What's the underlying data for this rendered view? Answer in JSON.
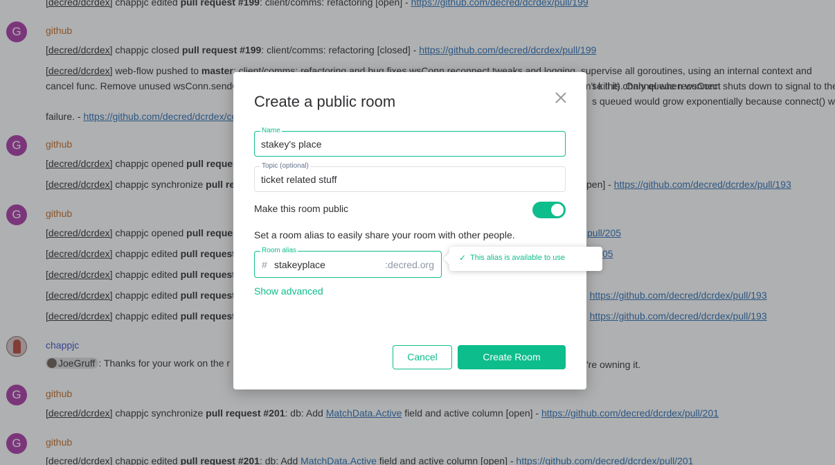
{
  "timeline": {
    "row0": {
      "repo": "[decred/dcrdex]",
      "mid": " chappjc edited ",
      "pr": "pull request #199",
      "desc": ": client/comms: refactoring [open] - ",
      "link": "https://github.com/decred/dcrdex/pull/199"
    },
    "group1": {
      "avatar": "G",
      "sender": "github",
      "row1": {
        "repo": "[decred/dcrdex]",
        "mid": " chappjc closed ",
        "pr": "pull request #199",
        "desc": ": client/comms: refactoring [closed] - ",
        "link": "https://github.com/decred/dcrdex/pull/199"
      },
      "row2": {
        "repo": "[decred/dcrdex]",
        "mid": " web-flow pushed to ",
        "branch": "master",
        "desc": ": client/comms: refactoring and bug fixes wsConn reconnect tweaks and logging. supervise all goroutines, using an internal context and cancel func. Remove unused wsConn.sendCh field. Allow (*wsConn).Connect to be called multiple times with dead (if they didn't kill it). Only queue reconnect ",
        "tail": "se this channel when wsConn shuts down to signal to the",
        "tail2": "s queued would grow exponentially because connect() was",
        "pre_link": "failure. - ",
        "link": "https://github.com/decred/dcrdex/co"
      }
    },
    "group2": {
      "avatar": "G",
      "sender": "github",
      "row1": {
        "repo": "[decred/dcrdex]",
        "mid": " chappjc opened ",
        "pr": "pull request"
      },
      "row2": {
        "repo": "[decred/dcrdex]",
        "mid": " chappjc synchronize ",
        "pr": "pull re",
        "tail": "pen] - ",
        "link": "https://github.com/decred/dcrdex/pull/193"
      }
    },
    "group3": {
      "avatar": "G",
      "sender": "github",
      "rows": [
        {
          "repo": "[decred/dcrdex]",
          "mid": " chappjc opened ",
          "pr": "pull request",
          "tail_link": "pull/205"
        },
        {
          "repo": "[decred/dcrdex]",
          "mid": " chappjc edited ",
          "pr": "pull request",
          "tail_link": "05"
        },
        {
          "repo": "[decred/dcrdex]",
          "mid": " chappjc edited ",
          "pr": "pull request"
        },
        {
          "repo": "[decred/dcrdex]",
          "mid": " chappjc edited ",
          "pr": "pull request",
          "tail": "- ",
          "link": "https://github.com/decred/dcrdex/pull/193"
        },
        {
          "repo": "[decred/dcrdex]",
          "mid": " chappjc edited ",
          "pr": "pull request",
          "tail": "- ",
          "link": "https://github.com/decred/dcrdex/pull/193"
        }
      ]
    },
    "group4": {
      "sender": "chappjc",
      "mention": "JoeGruff",
      "text": ": Thanks for your work on the r",
      "tail": "'re owning it."
    },
    "group5": {
      "avatar": "G",
      "sender": "github",
      "row1": {
        "repo": "[decred/dcrdex]",
        "mid": " chappjc synchronize ",
        "pr": "pull request #201",
        "desc1": ": db: Add ",
        "code": "MatchData.Active",
        "desc2": " field and active column [open] - ",
        "link": "https://github.com/decred/dcrdex/pull/201"
      }
    },
    "group6": {
      "avatar": "G",
      "sender": "github",
      "row1": {
        "repo": "[decred/dcrdex]",
        "mid": " chappjc edited ",
        "pr": "pull request #201",
        "desc1": ": db: Add ",
        "code": "MatchData.Active",
        "desc2": " field and active column [open] - ",
        "link": "https://github.com/decred/dcrdex/pull/201"
      }
    }
  },
  "dialog": {
    "title": "Create a public room",
    "name_label": "Name",
    "name_value": "stakey's place",
    "topic_label": "Topic (optional)",
    "topic_value": "ticket related stuff",
    "public_label": "Make this room public",
    "public_enabled": true,
    "alias_description": "Set a room alias to easily share your room with other people.",
    "alias_label": "Room alias",
    "alias_prefix": "#",
    "alias_value": "stakeyplace",
    "alias_domain": ":decred.org",
    "alias_tooltip": "This alias is available to use",
    "show_advanced": "Show advanced",
    "cancel_label": "Cancel",
    "create_label": "Create Room"
  },
  "colors": {
    "accent": "#0dbd8b",
    "link": "#2a6fb5",
    "github_sender": "#c36c25",
    "user_sender": "#3e55c9",
    "avatar": "#ac3ba8"
  }
}
